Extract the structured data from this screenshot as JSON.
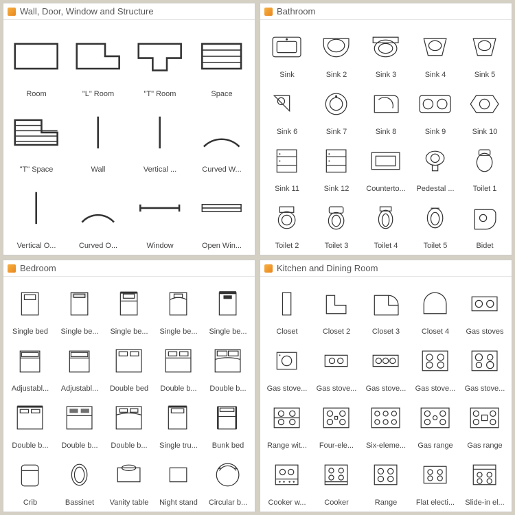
{
  "panels": [
    {
      "title": "Wall, Door, Window and Structure",
      "cols": 4,
      "items": [
        {
          "label": "Room",
          "icon": "rect"
        },
        {
          "label": "\"L\" Room",
          "icon": "lroom"
        },
        {
          "label": "\"T\" Room",
          "icon": "troom"
        },
        {
          "label": "Space",
          "icon": "hatch"
        },
        {
          "label": "\"T\" Space",
          "icon": "tspace"
        },
        {
          "label": "Wall",
          "icon": "vline"
        },
        {
          "label": "Vertical ...",
          "icon": "vbar"
        },
        {
          "label": "Curved W...",
          "icon": "arc"
        },
        {
          "label": "Vertical O...",
          "icon": "vline"
        },
        {
          "label": "Curved O...",
          "icon": "arc2"
        },
        {
          "label": "Window",
          "icon": "window"
        },
        {
          "label": "Open Win...",
          "icon": "openwin"
        }
      ]
    },
    {
      "title": "Bathroom",
      "cols": 5,
      "items": [
        {
          "label": "Sink",
          "icon": "sink"
        },
        {
          "label": "Sink 2",
          "icon": "sink-oval"
        },
        {
          "label": "Sink 3",
          "icon": "sink-round"
        },
        {
          "label": "Sink 4",
          "icon": "sink-trap"
        },
        {
          "label": "Sink 5",
          "icon": "sink-trap"
        },
        {
          "label": "Sink 6",
          "icon": "sink-tri"
        },
        {
          "label": "Sink 7",
          "icon": "sink-circle"
        },
        {
          "label": "Sink 8",
          "icon": "sink-corner"
        },
        {
          "label": "Sink 9",
          "icon": "sink-double"
        },
        {
          "label": "Sink 10",
          "icon": "sink-hex"
        },
        {
          "label": "Sink 11",
          "icon": "cab"
        },
        {
          "label": "Sink 12",
          "icon": "cab"
        },
        {
          "label": "Counterto...",
          "icon": "counter"
        },
        {
          "label": "Pedestal ...",
          "icon": "pedestal"
        },
        {
          "label": "Toilet 1",
          "icon": "toilet"
        },
        {
          "label": "Toilet 2",
          "icon": "toilet2"
        },
        {
          "label": "Toilet 3",
          "icon": "toilet3"
        },
        {
          "label": "Toilet 4",
          "icon": "toilet4"
        },
        {
          "label": "Toilet 5",
          "icon": "toilet5"
        },
        {
          "label": "Bidet",
          "icon": "bidet"
        }
      ]
    },
    {
      "title": "Bedroom",
      "cols": 5,
      "items": [
        {
          "label": "Single bed",
          "icon": "bed"
        },
        {
          "label": "Single be...",
          "icon": "bed2"
        },
        {
          "label": "Single be...",
          "icon": "bed3"
        },
        {
          "label": "Single be...",
          "icon": "bed4"
        },
        {
          "label": "Single be...",
          "icon": "bed5"
        },
        {
          "label": "Adjustabl...",
          "icon": "bed-adj"
        },
        {
          "label": "Adjustabl...",
          "icon": "bed-adj"
        },
        {
          "label": "Double bed",
          "icon": "dbed"
        },
        {
          "label": "Double b...",
          "icon": "dbed2"
        },
        {
          "label": "Double b...",
          "icon": "dbed3"
        },
        {
          "label": "Double b...",
          "icon": "dbed4"
        },
        {
          "label": "Double b...",
          "icon": "dbed5"
        },
        {
          "label": "Double b...",
          "icon": "dbed6"
        },
        {
          "label": "Single tru...",
          "icon": "trundle"
        },
        {
          "label": "Bunk bed",
          "icon": "bunk"
        },
        {
          "label": "Crib",
          "icon": "crib"
        },
        {
          "label": "Bassinet",
          "icon": "bassinet"
        },
        {
          "label": "Vanity table",
          "icon": "vanity"
        },
        {
          "label": "Night stand",
          "icon": "night"
        },
        {
          "label": "Circular b...",
          "icon": "circbed"
        }
      ]
    },
    {
      "title": "Kitchen and Dining Room",
      "cols": 5,
      "items": [
        {
          "label": "Closet",
          "icon": "closet"
        },
        {
          "label": "Closet 2",
          "icon": "closet-l"
        },
        {
          "label": "Closet 3",
          "icon": "closet-l2"
        },
        {
          "label": "Closet 4",
          "icon": "closet-d"
        },
        {
          "label": "Gas stoves",
          "icon": "stove2"
        },
        {
          "label": "Gas stove...",
          "icon": "stove1"
        },
        {
          "label": "Gas stove...",
          "icon": "stove-sm2"
        },
        {
          "label": "Gas stove...",
          "icon": "stove-sm3"
        },
        {
          "label": "Gas stove...",
          "icon": "stove4"
        },
        {
          "label": "Gas stove...",
          "icon": "stove4b"
        },
        {
          "label": "Range wit...",
          "icon": "range4"
        },
        {
          "label": "Four-ele...",
          "icon": "range4b"
        },
        {
          "label": "Six-eleme...",
          "icon": "range6"
        },
        {
          "label": "Gas range",
          "icon": "range5"
        },
        {
          "label": "Gas range",
          "icon": "range5b"
        },
        {
          "label": "Cooker w...",
          "icon": "cooker"
        },
        {
          "label": "Cooker",
          "icon": "cooker2"
        },
        {
          "label": "Range",
          "icon": "range"
        },
        {
          "label": "Flat electi...",
          "icon": "flat"
        },
        {
          "label": "Slide-in el...",
          "icon": "slide"
        }
      ]
    }
  ]
}
